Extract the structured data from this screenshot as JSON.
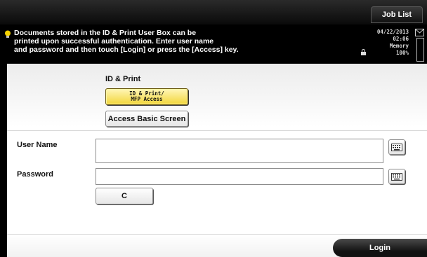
{
  "header": {
    "job_list_label": "Job List"
  },
  "message": {
    "lines": [
      "Documents stored in the ID & Print User Box can be",
      "printed upon successful authentication. Enter user name",
      "and password and then touch [Login] or press the [Access] key."
    ]
  },
  "status": {
    "date": "04/22/2013",
    "time": "02:06",
    "memory_label": "Memory",
    "memory_value": "100%"
  },
  "id_print": {
    "title": "ID & Print",
    "mode_button_line1": "ID & Print/",
    "mode_button_line2": "MFP Access",
    "basic_screen_button": "Access Basic Screen"
  },
  "form": {
    "user_name_label": "User Name",
    "user_name_value": "",
    "password_label": "Password",
    "password_value": "",
    "clear_button": "C"
  },
  "footer": {
    "login_button": "Login"
  },
  "colors": {
    "selected_button": "#f2d63a",
    "dark_bar": "#000000"
  },
  "icons": [
    "lightbulb-icon",
    "lock-icon",
    "mail-icon",
    "keyboard-icon"
  ]
}
